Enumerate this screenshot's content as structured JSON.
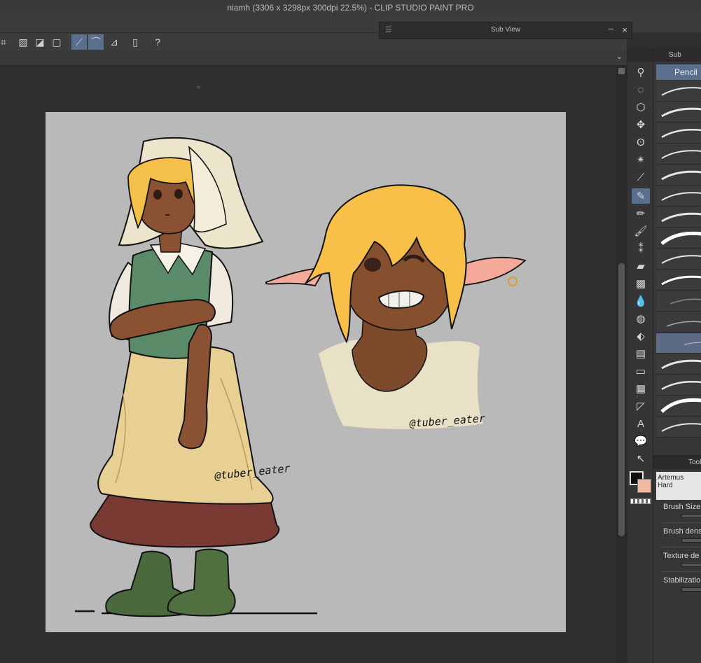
{
  "window": {
    "title": "niamh (3306 x 3298px 300dpi 22.5%)  - CLIP STUDIO PAINT PRO"
  },
  "sub_view": {
    "title": "Sub View",
    "minimize": "–",
    "close": "×"
  },
  "panels": {
    "sub_tool_tab": "Sub",
    "pencil_label": "Pencil",
    "tool_property_tab": "Tool",
    "brush_name": "Artemus Hard",
    "properties": [
      "Brush Size",
      "Brush dens",
      "Texture de",
      "Stabilizatio"
    ]
  },
  "artwork": {
    "signature_left": "@tuber_eater",
    "signature_right": "@tuber_eater"
  },
  "colors": {
    "main_color": "#0f0f10",
    "sub_color": "#f2b8a0",
    "canvas_bg": "#b9b9b9",
    "accent": "#5a6e8e"
  }
}
